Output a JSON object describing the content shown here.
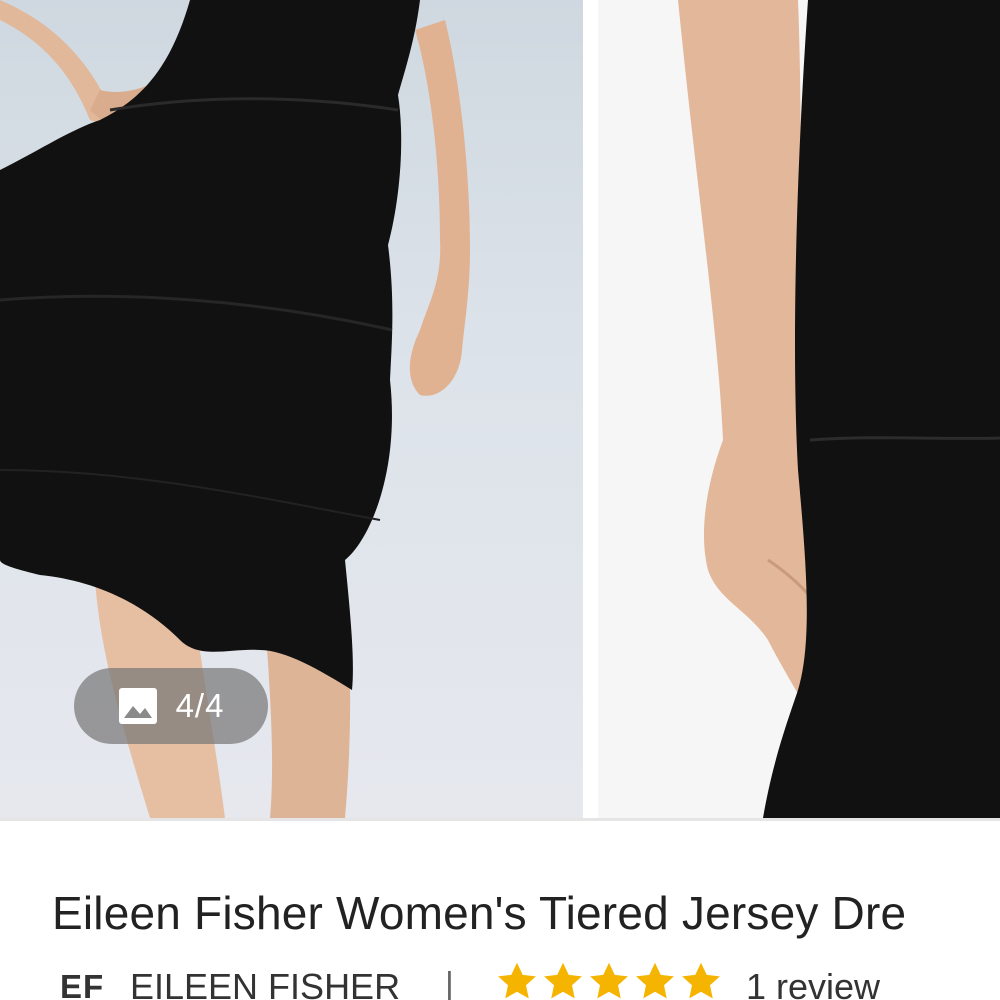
{
  "gallery": {
    "counter": "4/4",
    "counter_icon": "image-icon",
    "current_image": 4,
    "total_images": 4
  },
  "product": {
    "title": "Eileen Fisher Women's Tiered Jersey Dre",
    "brand_logo": "EF",
    "brand_name": "EILEEN FISHER",
    "separator": "|",
    "rating": 5,
    "rating_max": 5,
    "review_text": "1 review"
  },
  "colors": {
    "star": "#f5b400",
    "dress": "#111111",
    "pill": "#787878"
  }
}
